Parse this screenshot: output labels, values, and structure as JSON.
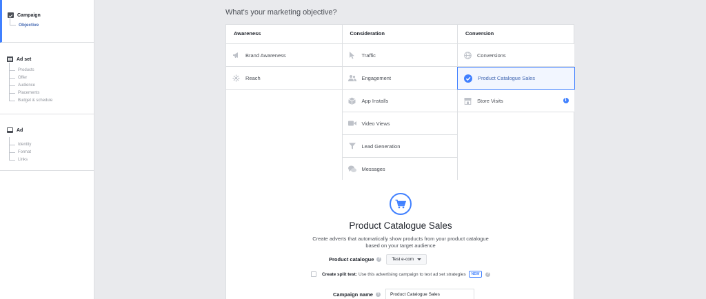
{
  "sidebar": {
    "campaign": {
      "title": "Campaign",
      "items": [
        "Objective"
      ]
    },
    "adset": {
      "title": "Ad set",
      "items": [
        "Products",
        "Offer",
        "Audience",
        "Placements",
        "Budget & schedule"
      ]
    },
    "ad": {
      "title": "Ad",
      "items": [
        "Identity",
        "Format",
        "Links"
      ]
    }
  },
  "main": {
    "title": "What's your marketing objective?",
    "columns": [
      {
        "heading": "Awareness",
        "objectives": [
          {
            "label": "Brand Awareness",
            "icon": "megaphone-icon"
          },
          {
            "label": "Reach",
            "icon": "reach-icon"
          }
        ]
      },
      {
        "heading": "Consideration",
        "objectives": [
          {
            "label": "Traffic",
            "icon": "cursor-icon"
          },
          {
            "label": "Engagement",
            "icon": "people-icon"
          },
          {
            "label": "App Installs",
            "icon": "box-icon"
          },
          {
            "label": "Video Views",
            "icon": "video-icon"
          },
          {
            "label": "Lead Generation",
            "icon": "funnel-icon"
          },
          {
            "label": "Messages",
            "icon": "chat-icon"
          }
        ]
      },
      {
        "heading": "Conversion",
        "objectives": [
          {
            "label": "Conversions",
            "icon": "globe-icon"
          },
          {
            "label": "Product Catalogue Sales",
            "icon": "check-icon",
            "selected": true
          },
          {
            "label": "Store Visits",
            "icon": "store-icon",
            "info": "i"
          }
        ]
      }
    ],
    "detail": {
      "icon": "cart-icon",
      "title": "Product Catalogue Sales",
      "description": "Create adverts that automatically show products from your product catalogue based on your target audience",
      "catalogue_label": "Product catalogue",
      "help_glyph": "?",
      "catalogue_value": "Test e-com",
      "split_test_label": "Create split test:",
      "split_test_desc": "Use this advertising campaign to test ad set strategies",
      "new_badge": "NEW",
      "campaign_name_label": "Campaign name",
      "campaign_name_value": "Product Catalogue Sales"
    }
  },
  "colors": {
    "accent": "#4080ff",
    "link": "#4267b2",
    "background": "#e9eaed",
    "border": "#dddfe2"
  }
}
